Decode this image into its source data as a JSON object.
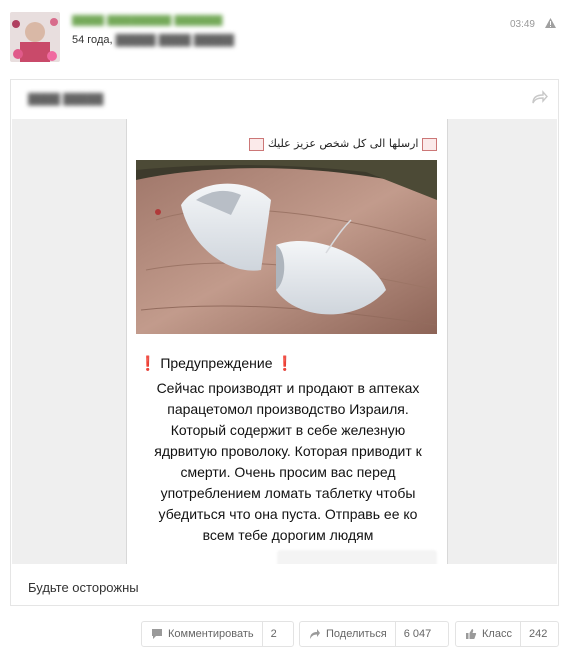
{
  "post": {
    "author_name": "▓▓▓▓ ▓▓▓▓▓▓▓▓ ▓▓▓▓▓▓",
    "age": "54 года,",
    "location": "▓▓▓▓▓ ▓▓▓▓ ▓▓▓▓▓",
    "time": "03:49",
    "warn_icon": "warning-icon"
  },
  "repost": {
    "group_name": "▓▓▓▓ ▓▓▓▓▓",
    "arabic_text": "ارسلها الى كل شخص عزيز عليك",
    "warning_title": "Предупреждение",
    "warning_mark": "❗",
    "body_lines": [
      "Сейчас производят и продают в аптеках",
      "парацетомол производство Израиля.",
      "Который содержит в себе железную",
      "ядрвитую проволоку. Которая приводит к",
      "смерти. Очень просим вас перед",
      "употреблением ломать таблетку чтобы",
      "убедиться что она пуста. Отправь ее ко",
      "всем тебе дорогим людям"
    ],
    "caption": "Будьте осторожны"
  },
  "actions": {
    "comment_label": "Комментировать",
    "comment_count": "2",
    "share_label": "Поделиться",
    "share_count": "6 047",
    "like_label": "Класс",
    "like_count": "242"
  },
  "colors": {
    "author_green": "#4a8f26",
    "warning_red": "#d0262c",
    "muted": "#999999"
  }
}
